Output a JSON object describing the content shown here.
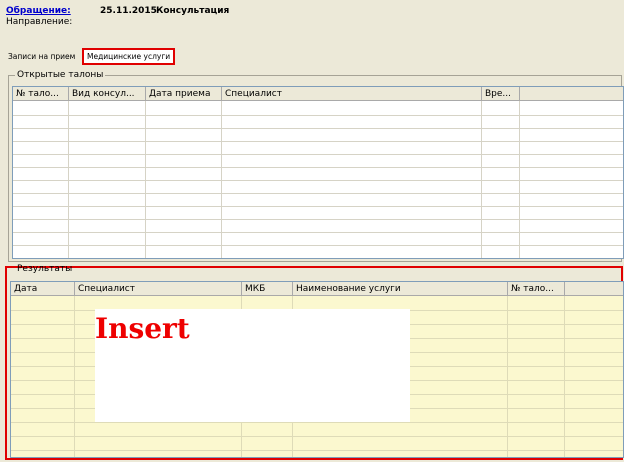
{
  "header": {
    "appeal_link": "Обращение:",
    "date": "25.11.2015",
    "type": "Консультация",
    "direction_label": "Направление:"
  },
  "tabs": [
    {
      "label": "Записи на прием",
      "active": false
    },
    {
      "label": "Медицинские услуги",
      "active": true
    }
  ],
  "open_tickets": {
    "title": "Открытые талоны",
    "columns": [
      "№ тало...",
      "Вид консул...",
      "Дата приема",
      "Специалист",
      "Вре..."
    ],
    "rows": []
  },
  "results": {
    "title": "Результаты",
    "columns": [
      "Дата",
      "Специалист",
      "МКБ",
      "Наименование услуги",
      "№ тало..."
    ],
    "rows": []
  },
  "overlay": {
    "label": "Insert"
  },
  "colors": {
    "highlight": "#e00000",
    "results_bg": "#fbf8cf",
    "window_bg": "#ece9d8",
    "link": "#0000cc"
  }
}
